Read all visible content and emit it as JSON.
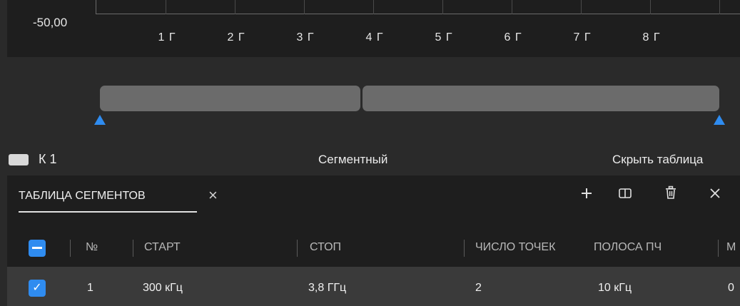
{
  "chart": {
    "y_label": "-50,00",
    "x_ticks": [
      "1 Г",
      "2 Г",
      "3 Г",
      "4 Г",
      "5 Г",
      "6 Г",
      "7 Г",
      "8 Г"
    ]
  },
  "status": {
    "channel_label": "К 1",
    "mode_label": "Сегментный",
    "hide_table_label": "Скрыть таблица"
  },
  "panel": {
    "tab_title": "ТАБЛИЦА СЕГМЕНТОВ",
    "close_symbol": "×",
    "tools": [
      "plus-icon",
      "split-icon",
      "trash-icon",
      "close-icon"
    ]
  },
  "table": {
    "columns": [
      "№",
      "СТАРТ",
      "СТОП",
      "ЧИСЛО ТОЧЕК",
      "ПОЛОСА ПЧ",
      "М"
    ],
    "rows": [
      {
        "num": "1",
        "start": "300 кГц",
        "stop": "3,8 ГГц",
        "points": "2",
        "ifbw": "10 кГц",
        "extra": "0"
      }
    ]
  },
  "colors": {
    "accent": "#2f8cf0",
    "segment": "#6b6b6b",
    "background": "#2a2a2a",
    "panel": "#1e1e1e"
  }
}
